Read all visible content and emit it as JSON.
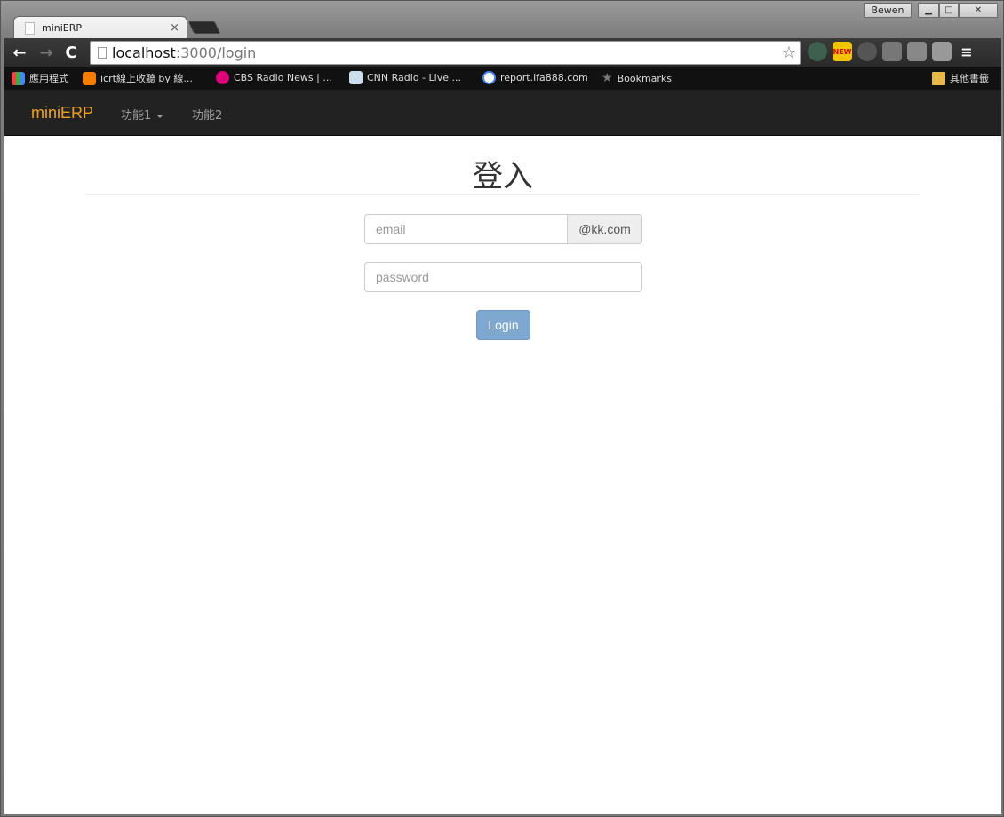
{
  "browser": {
    "tab_title": "miniERP",
    "tab_close": "×",
    "profile_name": "Bewen",
    "window_controls": {
      "minimize": "▁",
      "maximize": "□",
      "close": "✕"
    },
    "url_host": "localhost",
    "url_path": ":3000/login",
    "star": "☆",
    "nav": {
      "back": "←",
      "forward": "→",
      "reload": "C"
    },
    "extensions": {
      "new_badge": "NEW"
    },
    "bookmarks": {
      "apps": "應用程式",
      "icrt": "icrt線上收聽 by 線...",
      "cbs": "CBS Radio News | ...",
      "cnn": "CNN Radio - Live ...",
      "report": "report.ifa888.com",
      "bookmarks": "Bookmarks",
      "other": "其他書籤"
    }
  },
  "app": {
    "brand": "miniERP",
    "nav_item_1": "功能1",
    "nav_item_2": "功能2"
  },
  "login": {
    "heading": "登入",
    "email_placeholder": "email",
    "email_suffix": "@kk.com",
    "password_placeholder": "password",
    "submit_label": "Login"
  },
  "colors": {
    "brand": "#f0a020",
    "navbar": "#222222",
    "button": "#7ea8d0"
  }
}
